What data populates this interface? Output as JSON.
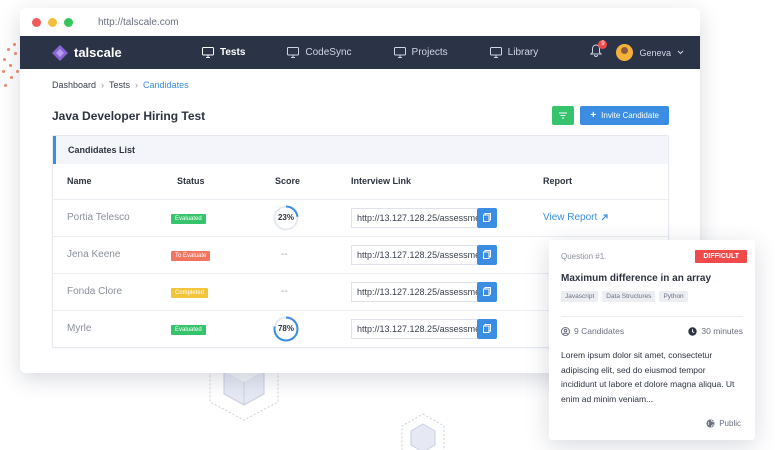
{
  "browser": {
    "url": "http://talscale.com"
  },
  "brand": {
    "name": "talscale"
  },
  "nav": {
    "items": [
      {
        "label": "Tests",
        "active": true
      },
      {
        "label": "CodeSync",
        "active": false
      },
      {
        "label": "Projects",
        "active": false
      },
      {
        "label": "Library",
        "active": false
      }
    ],
    "notification_count": "9",
    "user_name": "Geneva"
  },
  "breadcrumb": {
    "items": [
      "Dashboard",
      "Tests",
      "Candidates"
    ]
  },
  "page": {
    "title": "Java Developer Hiring Test",
    "invite_label": "Invite Candidate"
  },
  "candidates": {
    "card_title": "Candidates List",
    "columns": [
      "Name",
      "Status",
      "Score",
      "Interview Link",
      "Report"
    ],
    "rows": [
      {
        "name": "Portia Telesco",
        "status": "Evaluated",
        "status_color": "#35c46b",
        "score": "23%",
        "score_value": 23,
        "link": "http://13.127.128.25/assessment",
        "report": "View Report"
      },
      {
        "name": "Jena Keene",
        "status": "To Evaluate",
        "status_color": "#f0765f",
        "score": "--",
        "score_value": null,
        "link": "http://13.127.128.25/assessment",
        "report": ""
      },
      {
        "name": "Fonda Clore",
        "status": "Completed",
        "status_color": "#f3c53a",
        "score": "--",
        "score_value": null,
        "link": "http://13.127.128.25/assessment",
        "report": ""
      },
      {
        "name": "Myrle",
        "status": "Evaluated",
        "status_color": "#35c46b",
        "score": "78%",
        "score_value": 78,
        "link": "http://13.127.128.25/assessment",
        "report": ""
      }
    ]
  },
  "question": {
    "number": "Question #1.",
    "difficulty": "DIFFICULT",
    "title": "Maximum difference in an array",
    "tags": [
      "Javascript",
      "Data Structures",
      "Python"
    ],
    "candidates": "9 Candidates",
    "duration": "30 minutes",
    "description": "Lorem ipsum dolor sit amet, consectetur adipiscing elit, sed do eiusmod tempor incididunt ut labore et dolore magna aliqua. Ut enim ad minim veniam...",
    "visibility": "Public"
  },
  "colors": {
    "accent": "#3a8de0",
    "nav_bg": "#2b3447",
    "success": "#35c46b",
    "danger": "#ef4b4b",
    "warning": "#f3c53a"
  }
}
